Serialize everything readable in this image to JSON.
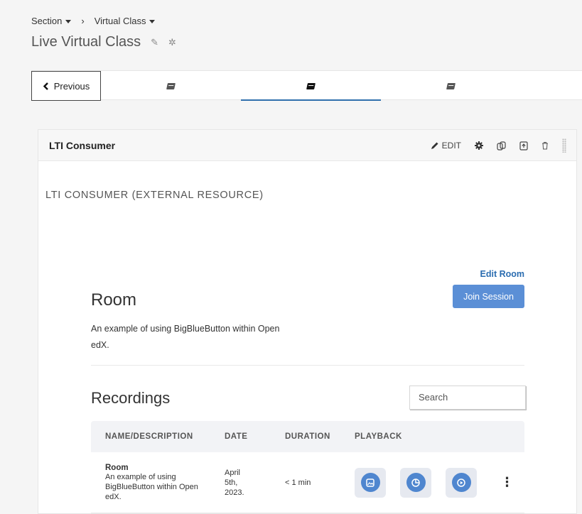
{
  "breadcrumb": {
    "section": "Section",
    "separator": "›",
    "subsection": "Virtual Class"
  },
  "unit": {
    "title": "Live Virtual Class"
  },
  "sequence_nav": {
    "previous_label": "Previous"
  },
  "xblock": {
    "title": "LTI Consumer",
    "edit_label": "EDIT",
    "external_label": "LTI CONSUMER (EXTERNAL RESOURCE)"
  },
  "room": {
    "edit_link": "Edit Room",
    "join_button": "Join Session",
    "title": "Room",
    "description": "An example of using BigBlueButton within Open edX."
  },
  "recordings": {
    "title": "Recordings",
    "search_placeholder": "Search",
    "columns": [
      "NAME/DESCRIPTION",
      "DATE",
      "DURATION",
      "PLAYBACK"
    ],
    "rows": [
      {
        "name": "Room",
        "description_lines": [
          "An example of using",
          "BigBlueButton within Open",
          "edX."
        ],
        "date_lines": [
          "April",
          "5th,",
          "2023."
        ],
        "duration": "< 1 min",
        "menu": "⋮"
      }
    ]
  },
  "colors": {
    "accent": "#2f6fad",
    "join_button": "#5b8fd6",
    "playback_icon": "#4f86cf",
    "playback_bg": "#e6e9f0"
  }
}
